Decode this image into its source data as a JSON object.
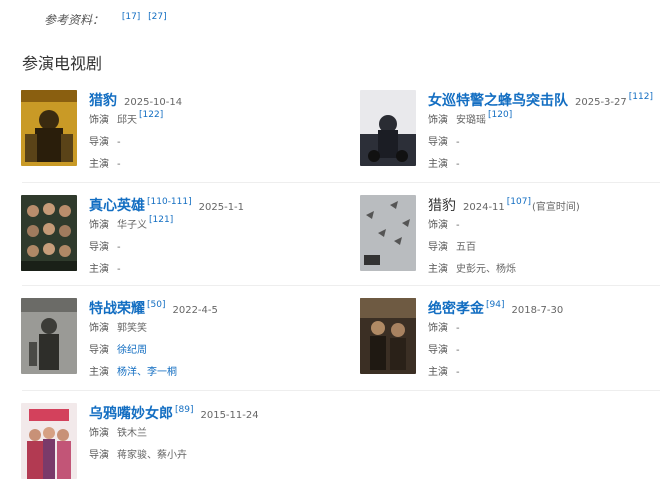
{
  "references": {
    "label": "参考资料：",
    "refs": [
      "[17]",
      "[27]"
    ]
  },
  "section_title": "参演电视剧",
  "roles": {
    "actor": "饰演",
    "director": "导演",
    "star": "主演"
  },
  "shows": [
    {
      "title": "猎豹",
      "date": "2025-10-14",
      "ref": "",
      "actor": "邱天",
      "actor_ref": "[122]",
      "director": "-",
      "star": "-"
    },
    {
      "title": "女巡特警之蜂鸟突击队",
      "date": "2025-3-27",
      "ref": "[112]",
      "actor": "安璐瑶",
      "actor_ref": "[120]",
      "director": "-",
      "star": "-"
    },
    {
      "title": "真心英雄",
      "date": "2025-1-1",
      "ref": "[110-111]",
      "actor": "华子义",
      "actor_ref": "[121]",
      "director": "-",
      "star": "-"
    },
    {
      "title": "猎豹",
      "date": "2024-11",
      "ref": "[107]",
      "note": "(官宣时间)",
      "actor": "-",
      "actor_ref": "",
      "director": "五百",
      "star": "史彭元、杨烁"
    },
    {
      "title": "特战荣耀",
      "date": "2022-4-5",
      "ref": "[50]",
      "actor": "郭笑笑",
      "actor_ref": "",
      "director": "徐纪周",
      "star": "杨洋、李一桐"
    },
    {
      "title": "绝密孝金",
      "date": "2018-7-30",
      "ref": "[94]",
      "actor": "-",
      "actor_ref": "",
      "director": "-",
      "star": "-"
    },
    {
      "title": "乌鸦嘴妙女郎",
      "date": "2015-11-24",
      "ref": "[89]",
      "actor": "铁木兰",
      "actor_ref": "",
      "director": "蒋家骏、蔡小卉",
      "star": ""
    }
  ],
  "colors": {
    "link": "#136ec2",
    "text": "#333333",
    "muted": "#666666"
  }
}
